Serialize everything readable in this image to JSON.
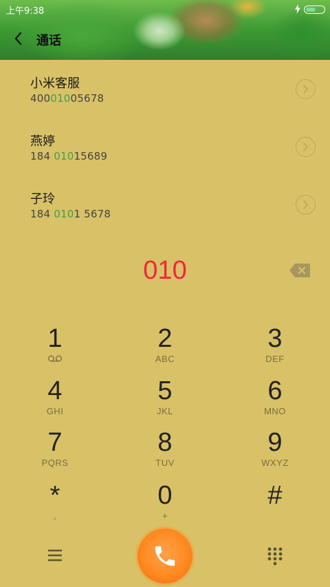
{
  "status_bar": {
    "time": "上午9:38",
    "battery_level": 0.55
  },
  "header": {
    "title": "通话"
  },
  "contacts": [
    {
      "name": "小米客服",
      "num_pre": "400",
      "num_match": "010",
      "num_post": "05678"
    },
    {
      "name": "燕婷",
      "num_pre": "184 ",
      "num_match": "010",
      "num_post": "15689"
    },
    {
      "name": "子玲",
      "num_pre": "184 ",
      "num_match": "010",
      "num_post": "1 5678"
    }
  ],
  "dial_input": "010",
  "keypad": [
    {
      "digit": "1",
      "sub": ""
    },
    {
      "digit": "2",
      "sub": "ABC"
    },
    {
      "digit": "3",
      "sub": "DEF"
    },
    {
      "digit": "4",
      "sub": "GHI"
    },
    {
      "digit": "5",
      "sub": "JKL"
    },
    {
      "digit": "6",
      "sub": "MNO"
    },
    {
      "digit": "7",
      "sub": "PQRS"
    },
    {
      "digit": "8",
      "sub": "TUV"
    },
    {
      "digit": "9",
      "sub": "WXYZ"
    },
    {
      "digit": "*",
      "sub": ","
    },
    {
      "digit": "0",
      "sub": "+"
    },
    {
      "digit": "#",
      "sub": ""
    }
  ],
  "colors": {
    "background": "#d8c166",
    "call_button": "#ff8a20",
    "match_highlight": "#3da24c",
    "input_text": "#f0273a"
  },
  "icons": {
    "back": "chevron-left-icon",
    "voicemail": "voicemail-icon",
    "backspace": "backspace-icon",
    "menu": "menu-icon",
    "call": "phone-icon",
    "keypad_toggle": "dialpad-icon"
  }
}
